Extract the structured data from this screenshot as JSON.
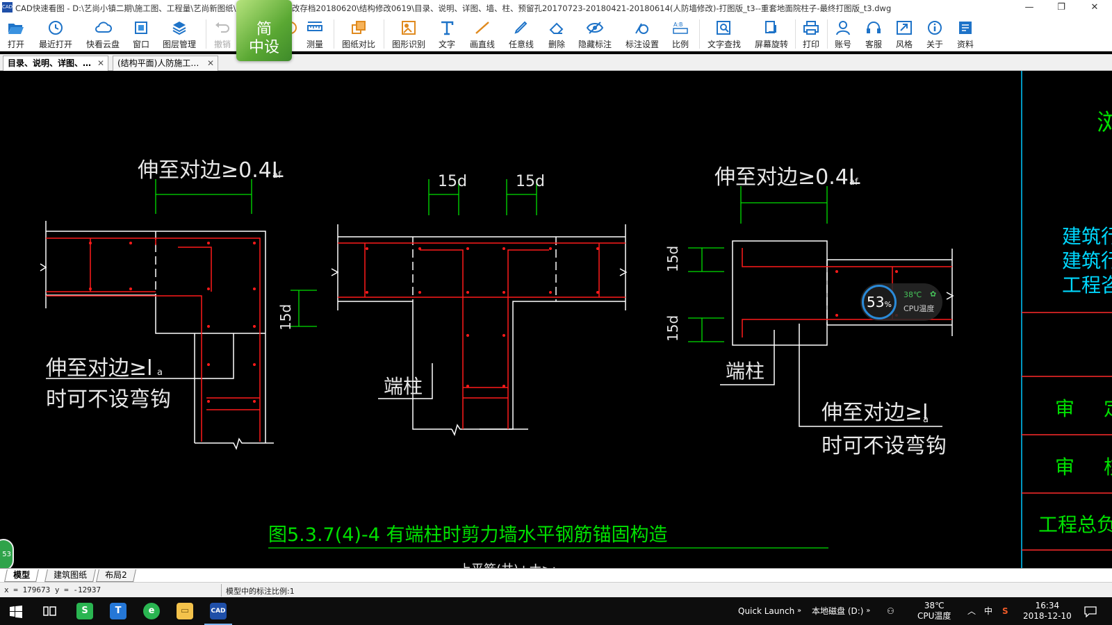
{
  "window": {
    "app_icon_text": "CAD",
    "title": "CAD快速看图 - D:\\艺尚小镇二期\\施工图、工程量\\艺尚新图纸\\艺尚项目人防修改存档20180620\\结构修改0619\\目录、说明、详图、墙、柱、预留孔20170723-20180421-20180614(人防墙修改)-打图版_t3--重套地面院柱子-最终打图版_t3.dwg",
    "minimize": "—",
    "restore": "❐",
    "close": "✕"
  },
  "promo": {
    "line1": "简",
    "line2": "中设"
  },
  "toolbar": {
    "open": "打开",
    "recent": "最近打开",
    "cloud": "快看云盘",
    "window": "窗口",
    "layers": "图层管理",
    "undo": "撤销",
    "hidden_label": "",
    "measure": "测量",
    "compare": "图纸对比",
    "shape_recog": "图形识别",
    "text": "文字",
    "line": "画直线",
    "freeline": "任意线",
    "delete": "删除",
    "hide_mark": "隐藏标注",
    "mark_settings": "标注设置",
    "scale": "比例",
    "text_search": "文字查找",
    "rotate": "屏幕旋转",
    "print": "打印",
    "account": "账号",
    "service": "客服",
    "style": "风格",
    "about": "关于",
    "resources": "资料"
  },
  "tabs": [
    {
      "label": "目录、说明、详图、…",
      "close": "✕"
    },
    {
      "label": "(结构平面)人防施工…",
      "close": "✕"
    }
  ],
  "drawing": {
    "labels": {
      "extend_04L_left": "伸至对边≥0.4L",
      "af_left": "af",
      "d15_a": "15d",
      "d15_b": "15d",
      "extend_04L_right": "伸至对边≥0.4L",
      "af_right": "af",
      "d15_vertical_left": "15d",
      "d15_vertical_right_top": "15d",
      "d15_vertical_right_bottom": "15d",
      "extend_la_left": "伸至对边≥l",
      "a_left": "a",
      "nohook_left": "时可不设弯钩",
      "end_column_mid": "端柱",
      "end_column_right": "端柱",
      "extend_la_right": "伸至对边≥l",
      "a_right": "a",
      "nohook_right": "时可不设弯钩",
      "figure_caption": "图5.3.7(4)-4  有端柱时剪力墙水平钢筋锚固构造",
      "partial_text_bottom": "上平筋(共)+ナ>:"
    },
    "title_block": {
      "top_glyph": "浏",
      "line1": "建筑行",
      "line2": "建筑行",
      "line3": "工程咨",
      "review1": "审",
      "review1_b": "定",
      "review2": "审",
      "review2_b": "核",
      "engineer": "工程总负"
    },
    "colors": {
      "background": "#000000",
      "wall_outline": "#ffffff",
      "rebar": "#ff1a1a",
      "dimension": "#00e000",
      "title_block_line": "#ff2a2a",
      "title_block_text": "#00d8ff",
      "frame_line": "#00c8ff"
    }
  },
  "cpu_widget": {
    "usage": "53",
    "unit": "%",
    "temperature": "38℃",
    "label": "CPU温度"
  },
  "left_bubble": "53",
  "layout_tabs": [
    "模型",
    "建筑图纸",
    "布局2"
  ],
  "status": {
    "coords": "x = 179673  y = -12937",
    "scale_text": "模型中的标注比例:1"
  },
  "taskbar": {
    "quick_launch": "Quick Launch",
    "drive": "本地磁盘 (D:)",
    "temp": "38℃",
    "temp_label": "CPU温度",
    "ime": "中",
    "time": "16:34",
    "date": "2018-12-10"
  }
}
